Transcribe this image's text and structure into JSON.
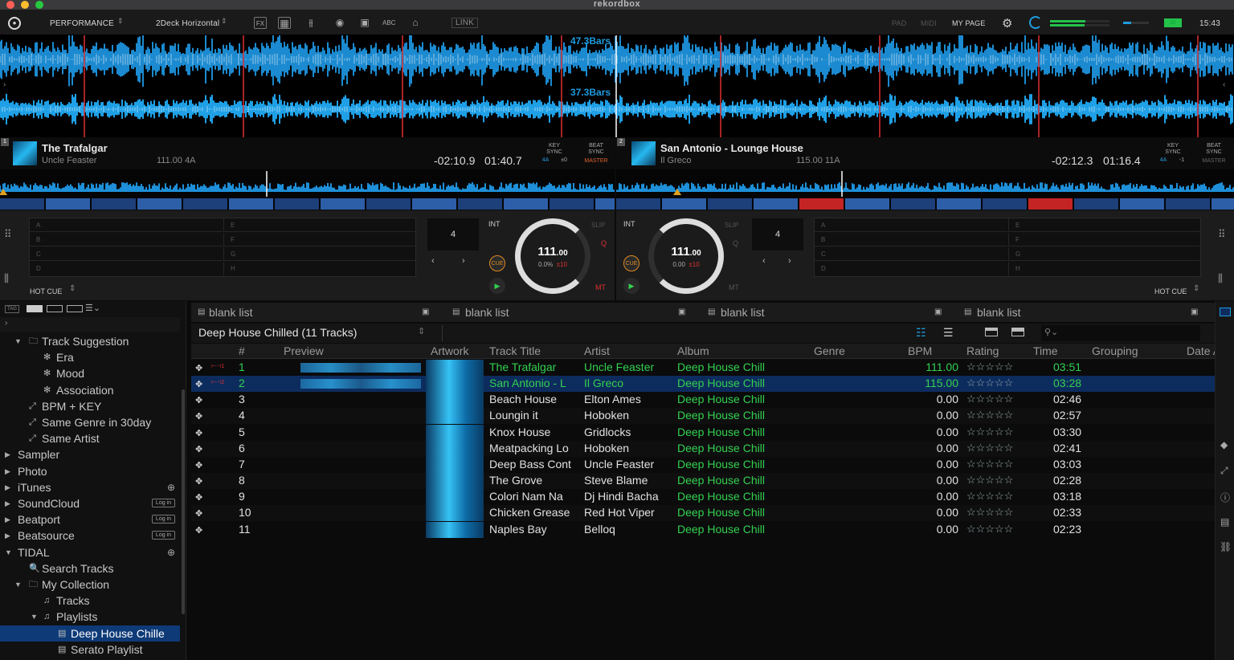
{
  "app_title": "rekordbox",
  "toolbar": {
    "mode": "PERFORMANCE",
    "layout": "2Deck Horizontal",
    "link": "LINK",
    "pad": "PAD",
    "midi": "MIDI",
    "my_page": "MY PAGE",
    "clock": "15:43",
    "battery": "30"
  },
  "waveform": {
    "upper_bars": "47.3Bars",
    "lower_bars": "37.3Bars"
  },
  "decks": [
    {
      "num": "1",
      "title": "The Trafalgar",
      "artist": "Uncle Feaster",
      "bpm_key": "111.00  4A",
      "remain": "-02:10.9",
      "elapsed": "01:40.7",
      "key_sync": "KEY SYNC",
      "key_val": "4A",
      "key_off": "±0",
      "beat_sync": "BEAT SYNC",
      "master": "MASTER",
      "beat_jump": "4",
      "int": "INT",
      "slip": "SLIP",
      "q": "Q",
      "mt": "MT",
      "cue": "CUE",
      "jog_bpm": "111",
      "jog_bpm_dec": ".00",
      "jog_pitch": "0.0%",
      "jog_range": "±10",
      "hot_cue": "HOT CUE",
      "pads_left": [
        "A",
        "B",
        "C",
        "D"
      ],
      "pads_right": [
        "E",
        "F",
        "G",
        "H"
      ]
    },
    {
      "num": "2",
      "title": "San Antonio - Lounge House",
      "artist": "Il Greco",
      "bpm_key": "115.00  11A",
      "remain": "-02:12.3",
      "elapsed": "01:16.4",
      "key_sync": "KEY SYNC",
      "key_val": "4A",
      "key_off": "-1",
      "beat_sync": "BEAT SYNC",
      "master": "MASTER",
      "beat_jump": "4",
      "int": "INT",
      "slip": "SLIP",
      "q": "Q",
      "mt": "MT",
      "cue": "CUE",
      "jog_bpm": "111",
      "jog_bpm_dec": ".00",
      "jog_pitch": "0.00",
      "jog_range": "±10",
      "hot_cue": "HOT CUE",
      "pads_left": [
        "A",
        "B",
        "C",
        "D"
      ],
      "pads_right": [
        "E",
        "F",
        "G",
        "H"
      ]
    }
  ],
  "sidebar": {
    "tag": "TAG",
    "items": [
      {
        "label": "Track Suggestion",
        "level": 1,
        "arrow": "▼",
        "icon": "🗀"
      },
      {
        "label": "Era",
        "level": 2,
        "arrow": "",
        "icon": "✻"
      },
      {
        "label": "Mood",
        "level": 2,
        "arrow": "",
        "icon": "✻"
      },
      {
        "label": "Association",
        "level": 2,
        "arrow": "",
        "icon": "✻"
      },
      {
        "label": "BPM + KEY",
        "level": 1,
        "arrow": "",
        "icon": "⤢"
      },
      {
        "label": "Same Genre in 30day",
        "level": 1,
        "arrow": "",
        "icon": "⤢"
      },
      {
        "label": "Same Artist",
        "level": 1,
        "arrow": "",
        "icon": "⤢"
      },
      {
        "label": "Sampler",
        "level": 0,
        "arrow": "▶",
        "icon": ""
      },
      {
        "label": "Photo",
        "level": 0,
        "arrow": "▶",
        "icon": ""
      },
      {
        "label": "iTunes",
        "level": 0,
        "arrow": "▶",
        "icon": ""
      },
      {
        "label": "SoundCloud",
        "level": 0,
        "arrow": "▶",
        "icon": "",
        "login": "Log in"
      },
      {
        "label": "Beatport",
        "level": 0,
        "arrow": "▶",
        "icon": "",
        "login": "Log in"
      },
      {
        "label": "Beatsource",
        "level": 0,
        "arrow": "▶",
        "icon": "",
        "login": "Log in"
      },
      {
        "label": "TIDAL",
        "level": 0,
        "arrow": "▼",
        "icon": ""
      },
      {
        "label": "Search Tracks",
        "level": 1,
        "arrow": "",
        "icon": "🔍"
      },
      {
        "label": "My Collection",
        "level": 1,
        "arrow": "▼",
        "icon": "🗀"
      },
      {
        "label": "Tracks",
        "level": 2,
        "arrow": "",
        "icon": "♫"
      },
      {
        "label": "Playlists",
        "level": 2,
        "arrow": "▼",
        "icon": "♫"
      },
      {
        "label": "Deep House Chille",
        "level": 3,
        "arrow": "",
        "icon": "▤",
        "selected": true
      },
      {
        "label": "Serato Playlist",
        "level": 3,
        "arrow": "",
        "icon": "▤"
      }
    ]
  },
  "tabs": [
    "blank list",
    "blank list",
    "blank list",
    "blank list"
  ],
  "playlist_title": "Deep House Chilled (11 Tracks)",
  "columns": [
    "#",
    "Preview",
    "Artwork",
    "Track Title",
    "Artist",
    "Album",
    "Genre",
    "BPM",
    "Rating",
    "Time",
    "Grouping",
    "Date A"
  ],
  "tracks": [
    {
      "n": "1",
      "title": "The Trafalgar",
      "artist": "Uncle Feaster",
      "album": "Deep House Chill",
      "bpm": "111.00",
      "time": "03:51",
      "state": "loaded1",
      "deck": "1"
    },
    {
      "n": "2",
      "title": "San Antonio - L",
      "artist": "Il Greco",
      "album": "Deep House Chill",
      "bpm": "115.00",
      "time": "03:28",
      "state": "loaded2",
      "deck": "2"
    },
    {
      "n": "3",
      "title": "Beach House",
      "artist": "Elton Ames",
      "album": "Deep House Chill",
      "bpm": "0.00",
      "time": "02:46"
    },
    {
      "n": "4",
      "title": "Loungin it",
      "artist": "Hoboken",
      "album": "Deep House Chill",
      "bpm": "0.00",
      "time": "02:57"
    },
    {
      "n": "5",
      "title": "Knox House",
      "artist": "Gridlocks",
      "album": "Deep House Chill",
      "bpm": "0.00",
      "time": "03:30"
    },
    {
      "n": "6",
      "title": "Meatpacking Lo",
      "artist": "Hoboken",
      "album": "Deep House Chill",
      "bpm": "0.00",
      "time": "02:41"
    },
    {
      "n": "7",
      "title": "Deep Bass Cont",
      "artist": "Uncle Feaster",
      "album": "Deep House Chill",
      "bpm": "0.00",
      "time": "03:03"
    },
    {
      "n": "8",
      "title": "The Grove",
      "artist": "Steve Blame",
      "album": "Deep House Chill",
      "bpm": "0.00",
      "time": "02:28"
    },
    {
      "n": "9",
      "title": "Colori Nam Na",
      "artist": "Dj Hindi Bacha",
      "album": "Deep House Chill",
      "bpm": "0.00",
      "time": "03:18"
    },
    {
      "n": "10",
      "title": "Chicken Grease",
      "artist": "Red Hot Viper",
      "album": "Deep House Chill",
      "bpm": "0.00",
      "time": "02:33"
    },
    {
      "n": "11",
      "title": "Naples Bay",
      "artist": "Belloq",
      "album": "Deep House Chill",
      "bpm": "0.00",
      "time": "02:23"
    }
  ],
  "rating_stars": "☆☆☆☆☆",
  "colors": {
    "accent_blue": "#1f9bde",
    "wave_blue": "#1e8fd8",
    "loaded_green": "#33d14f",
    "select_row": "#0d2c5e",
    "red": "#e03030"
  }
}
